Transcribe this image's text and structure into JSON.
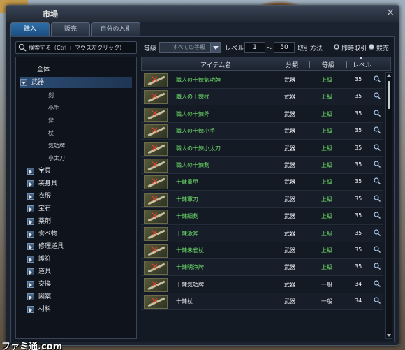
{
  "window": {
    "title": "市場",
    "close_label": "×"
  },
  "tabs": [
    {
      "label": "購入",
      "active": true
    },
    {
      "label": "販売",
      "active": false
    },
    {
      "label": "自分の入札",
      "active": false
    }
  ],
  "search": {
    "placeholder": "検索する（Ctrl + マウス左クリック）"
  },
  "filters": {
    "grade_label": "等級",
    "grade_value": "すべての等級",
    "level_label": "レベル",
    "level_min": "1",
    "level_sep": "〜",
    "level_max": "50",
    "method_label": "取引方法",
    "instant_label": "即時取引",
    "auction_label": "競売"
  },
  "tree": {
    "all": "全体",
    "selected": "武器",
    "sub": [
      "剣",
      "小手",
      "斧",
      "杖",
      "気功牌",
      "小太刀"
    ],
    "categories": [
      "宝貝",
      "装身具",
      "衣服",
      "宝石",
      "薬剤",
      "食べ物",
      "修理道具",
      "護符",
      "道具",
      "交換",
      "図案",
      "材料"
    ]
  },
  "table": {
    "headers": {
      "name": "アイテム名",
      "category": "分類",
      "grade": "等級",
      "level": "レベル"
    },
    "rows": [
      {
        "name": "職人の十錬気功牌",
        "category": "武器",
        "grade": "上級",
        "level": "35",
        "green": true
      },
      {
        "name": "職人の十錬杖",
        "category": "武器",
        "grade": "上級",
        "level": "35",
        "green": true
      },
      {
        "name": "職人の十錬斧",
        "category": "武器",
        "grade": "上級",
        "level": "35",
        "green": true
      },
      {
        "name": "職人の十錬小手",
        "category": "武器",
        "grade": "上級",
        "level": "35",
        "green": true
      },
      {
        "name": "職人の十錬小太刀",
        "category": "武器",
        "grade": "上級",
        "level": "35",
        "green": true
      },
      {
        "name": "職人の十錬剣",
        "category": "武器",
        "grade": "上級",
        "level": "35",
        "green": true
      },
      {
        "name": "十錬重甲",
        "category": "武器",
        "grade": "上級",
        "level": "35",
        "green": true
      },
      {
        "name": "十錬軍刀",
        "category": "武器",
        "grade": "上級",
        "level": "35",
        "green": true
      },
      {
        "name": "十錬細剣",
        "category": "武器",
        "grade": "上級",
        "level": "35",
        "green": true
      },
      {
        "name": "十錬激斧",
        "category": "武器",
        "grade": "上級",
        "level": "35",
        "green": true
      },
      {
        "name": "十錬朱雀杖",
        "category": "武器",
        "grade": "上級",
        "level": "35",
        "green": true
      },
      {
        "name": "十錬明浄牌",
        "category": "武器",
        "grade": "上級",
        "level": "35",
        "green": true
      },
      {
        "name": "十錬気功牌",
        "category": "武器",
        "grade": "一般",
        "level": "34",
        "green": false
      },
      {
        "name": "十錬杖",
        "category": "武器",
        "grade": "一般",
        "level": "34",
        "green": false
      }
    ]
  },
  "watermark": "ファミ通.com",
  "colors": {
    "accent": "#2d6ea8",
    "grade_high": "#6fe06a",
    "grade_normal": "#e8ecf0"
  }
}
